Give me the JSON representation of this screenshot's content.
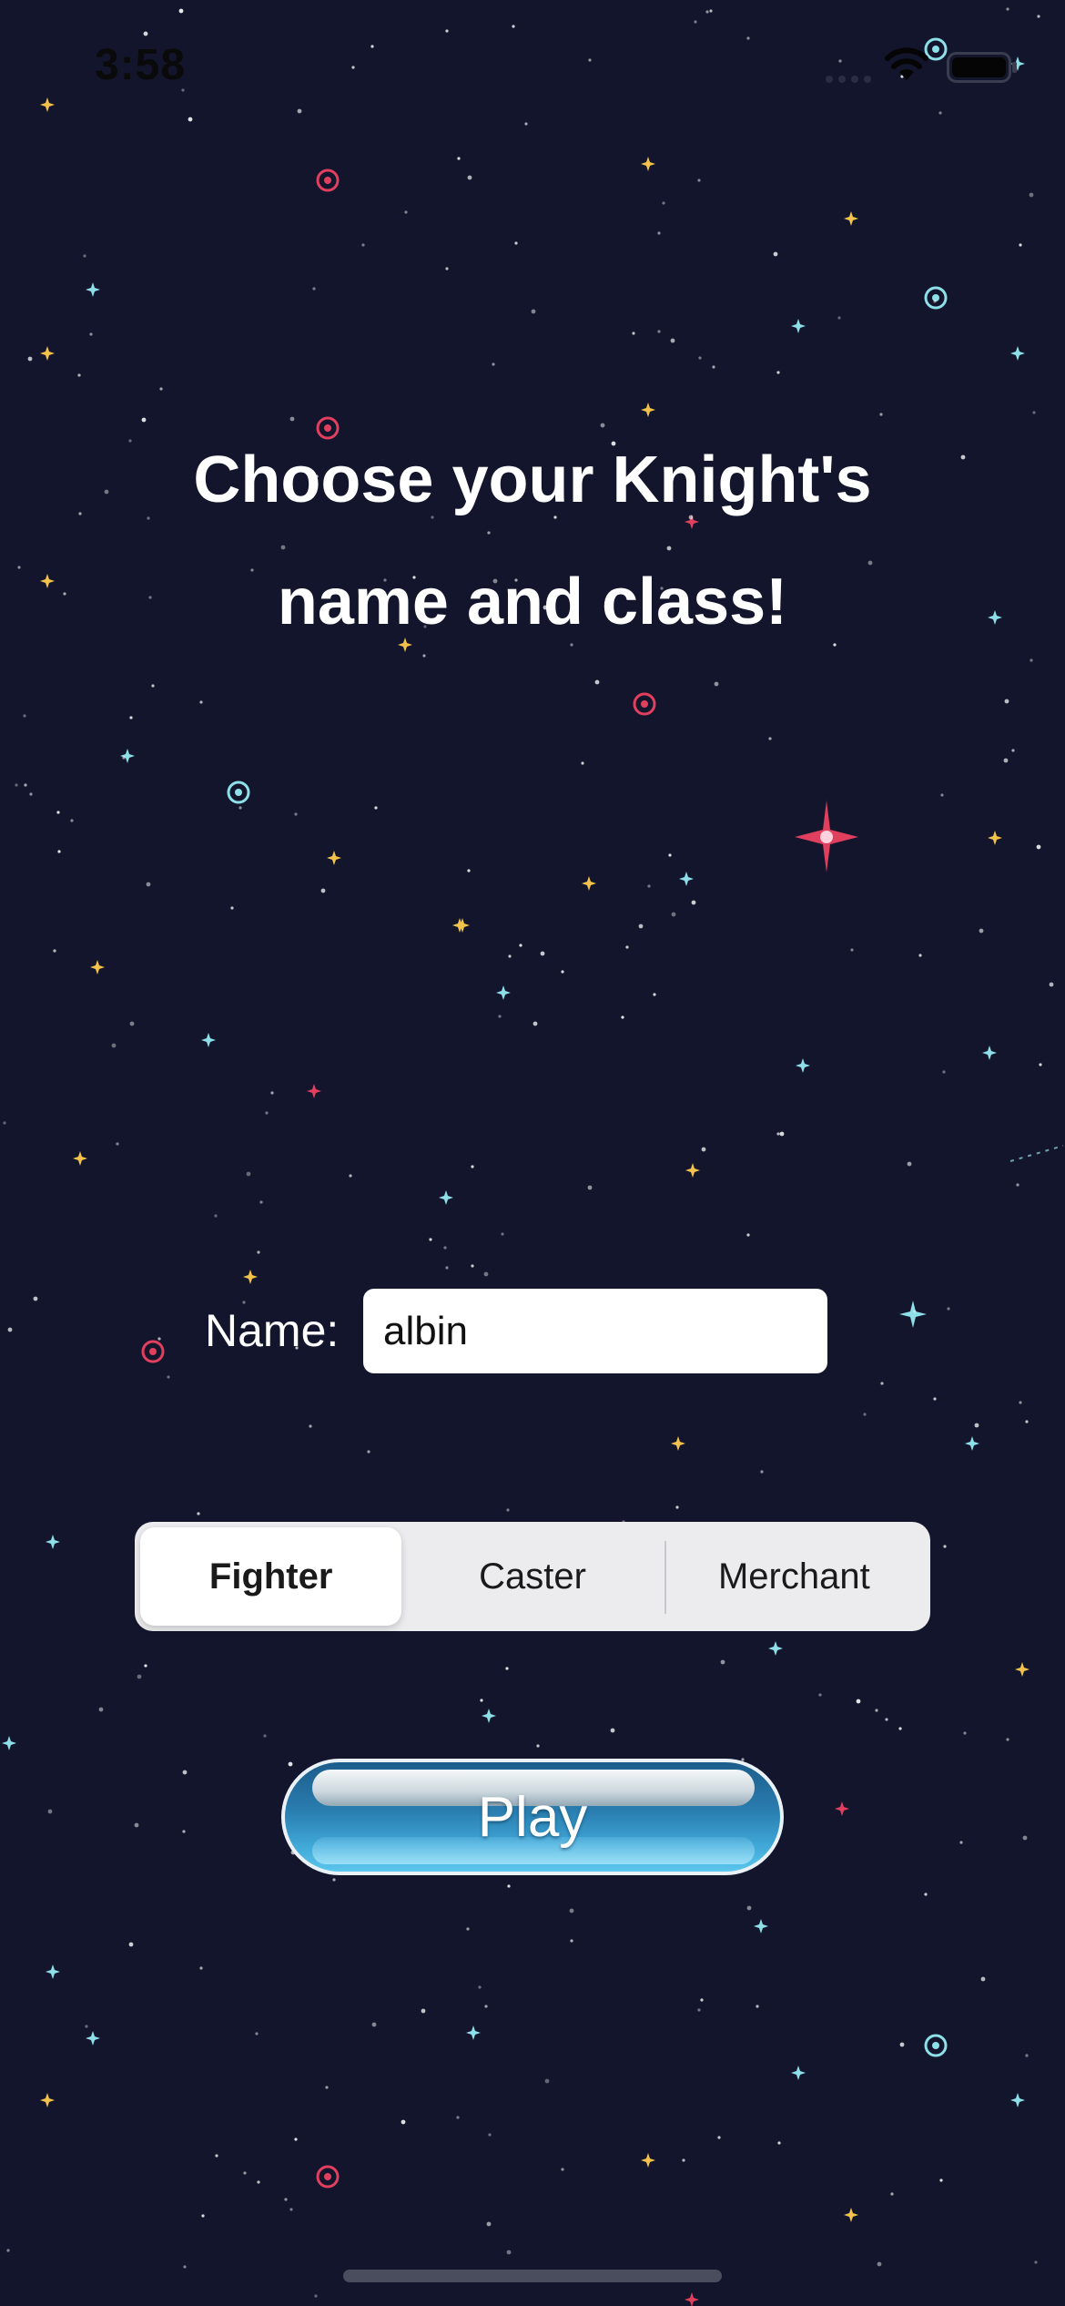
{
  "status_bar": {
    "time": "3:58",
    "icons": [
      "cellular-signal-icon",
      "wifi-icon",
      "battery-icon"
    ]
  },
  "title": {
    "line1": "Choose your Knight's",
    "line2": "name and class!"
  },
  "name_field": {
    "label": "Name:",
    "value": "albin",
    "placeholder": ""
  },
  "class_selector": {
    "options": [
      "Fighter",
      "Caster",
      "Merchant"
    ],
    "selected": "Fighter"
  },
  "play_button": {
    "label": "Play"
  },
  "colors": {
    "background": "#13152c",
    "star_pink": "#e0405e",
    "star_cyan": "#8ee0e8",
    "star_yellow": "#f2c24a",
    "star_white": "#ffffff",
    "button_blue": "#2a7eb0"
  }
}
